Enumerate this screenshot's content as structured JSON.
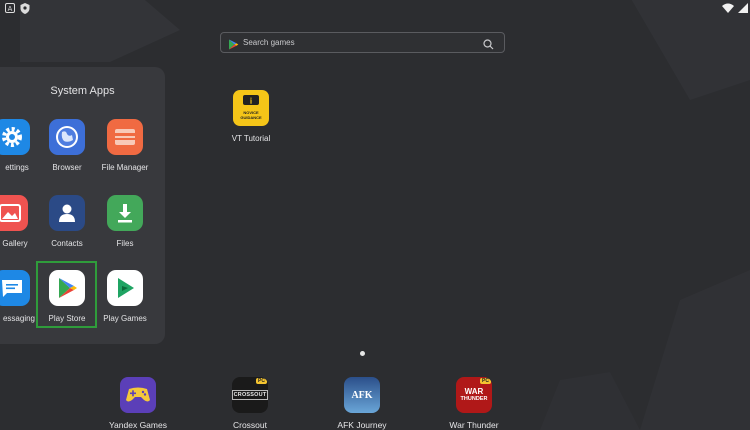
{
  "search": {
    "placeholder": "Search games"
  },
  "folder": {
    "title": "System Apps",
    "apps": [
      {
        "label": "Settings",
        "shown": "ettings",
        "icon": "gear-icon"
      },
      {
        "label": "Browser",
        "icon": "globe-icon"
      },
      {
        "label": "File Manager",
        "icon": "folder-icon"
      },
      {
        "label": "Gallery",
        "icon": "image-icon"
      },
      {
        "label": "Contacts",
        "icon": "person-icon"
      },
      {
        "label": "Files",
        "icon": "download-icon"
      },
      {
        "label": "Messaging",
        "shown": "essaging",
        "icon": "chat-icon"
      },
      {
        "label": "Play Store",
        "icon": "play-store-icon",
        "highlighted": true
      },
      {
        "label": "Play Games",
        "icon": "play-games-icon"
      }
    ]
  },
  "desktop": {
    "vt_tutorial": {
      "label": "VT Tutorial",
      "icon_text_1": "NOVICE",
      "icon_text_2": "GUIDANCE"
    }
  },
  "dock": [
    {
      "label": "Yandex Games",
      "icon": "gamepad-icon"
    },
    {
      "label": "Crossout",
      "icon_text": "CROSSOUT",
      "tag": "PC"
    },
    {
      "label": "AFK Journey",
      "icon_text": "AFK"
    },
    {
      "label": "War Thunder",
      "icon_text_1": "WAR",
      "icon_text_2": "THUNDER",
      "tag": "PC"
    }
  ],
  "colors": {
    "background": "#2c2d30",
    "folder_panel": "#38393d",
    "highlight": "#2f9c3b",
    "settings": "#1e88e5",
    "browser": "#3d6fd8",
    "file_manager": "#f06a42",
    "gallery": "#ef5350",
    "contacts": "#2b4a86",
    "files": "#43a85a"
  }
}
